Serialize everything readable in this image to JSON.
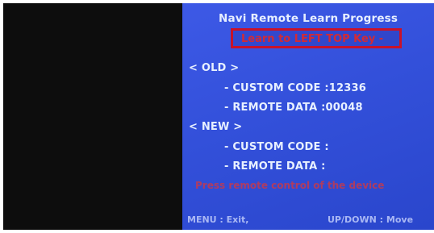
{
  "screen": {
    "title": "Navi Remote Learn Progress",
    "instruction": "Learn to LEFT TOP Key -",
    "old_header": "< OLD >",
    "old_custom_code": "- CUSTOM CODE :12336",
    "old_remote_data": "- REMOTE DATA :00048",
    "new_header": "< NEW >",
    "new_custom_code": "- CUSTOM CODE :",
    "new_remote_data": "- REMOTE DATA :",
    "prompt": "Press remote control of the device",
    "footer_left": "MENU : Exit,",
    "footer_right": "UP/DOWN : Move"
  },
  "colors": {
    "screen_bg": "#3350da",
    "highlight_border": "#c8122a",
    "text": "#e8f0ff"
  }
}
